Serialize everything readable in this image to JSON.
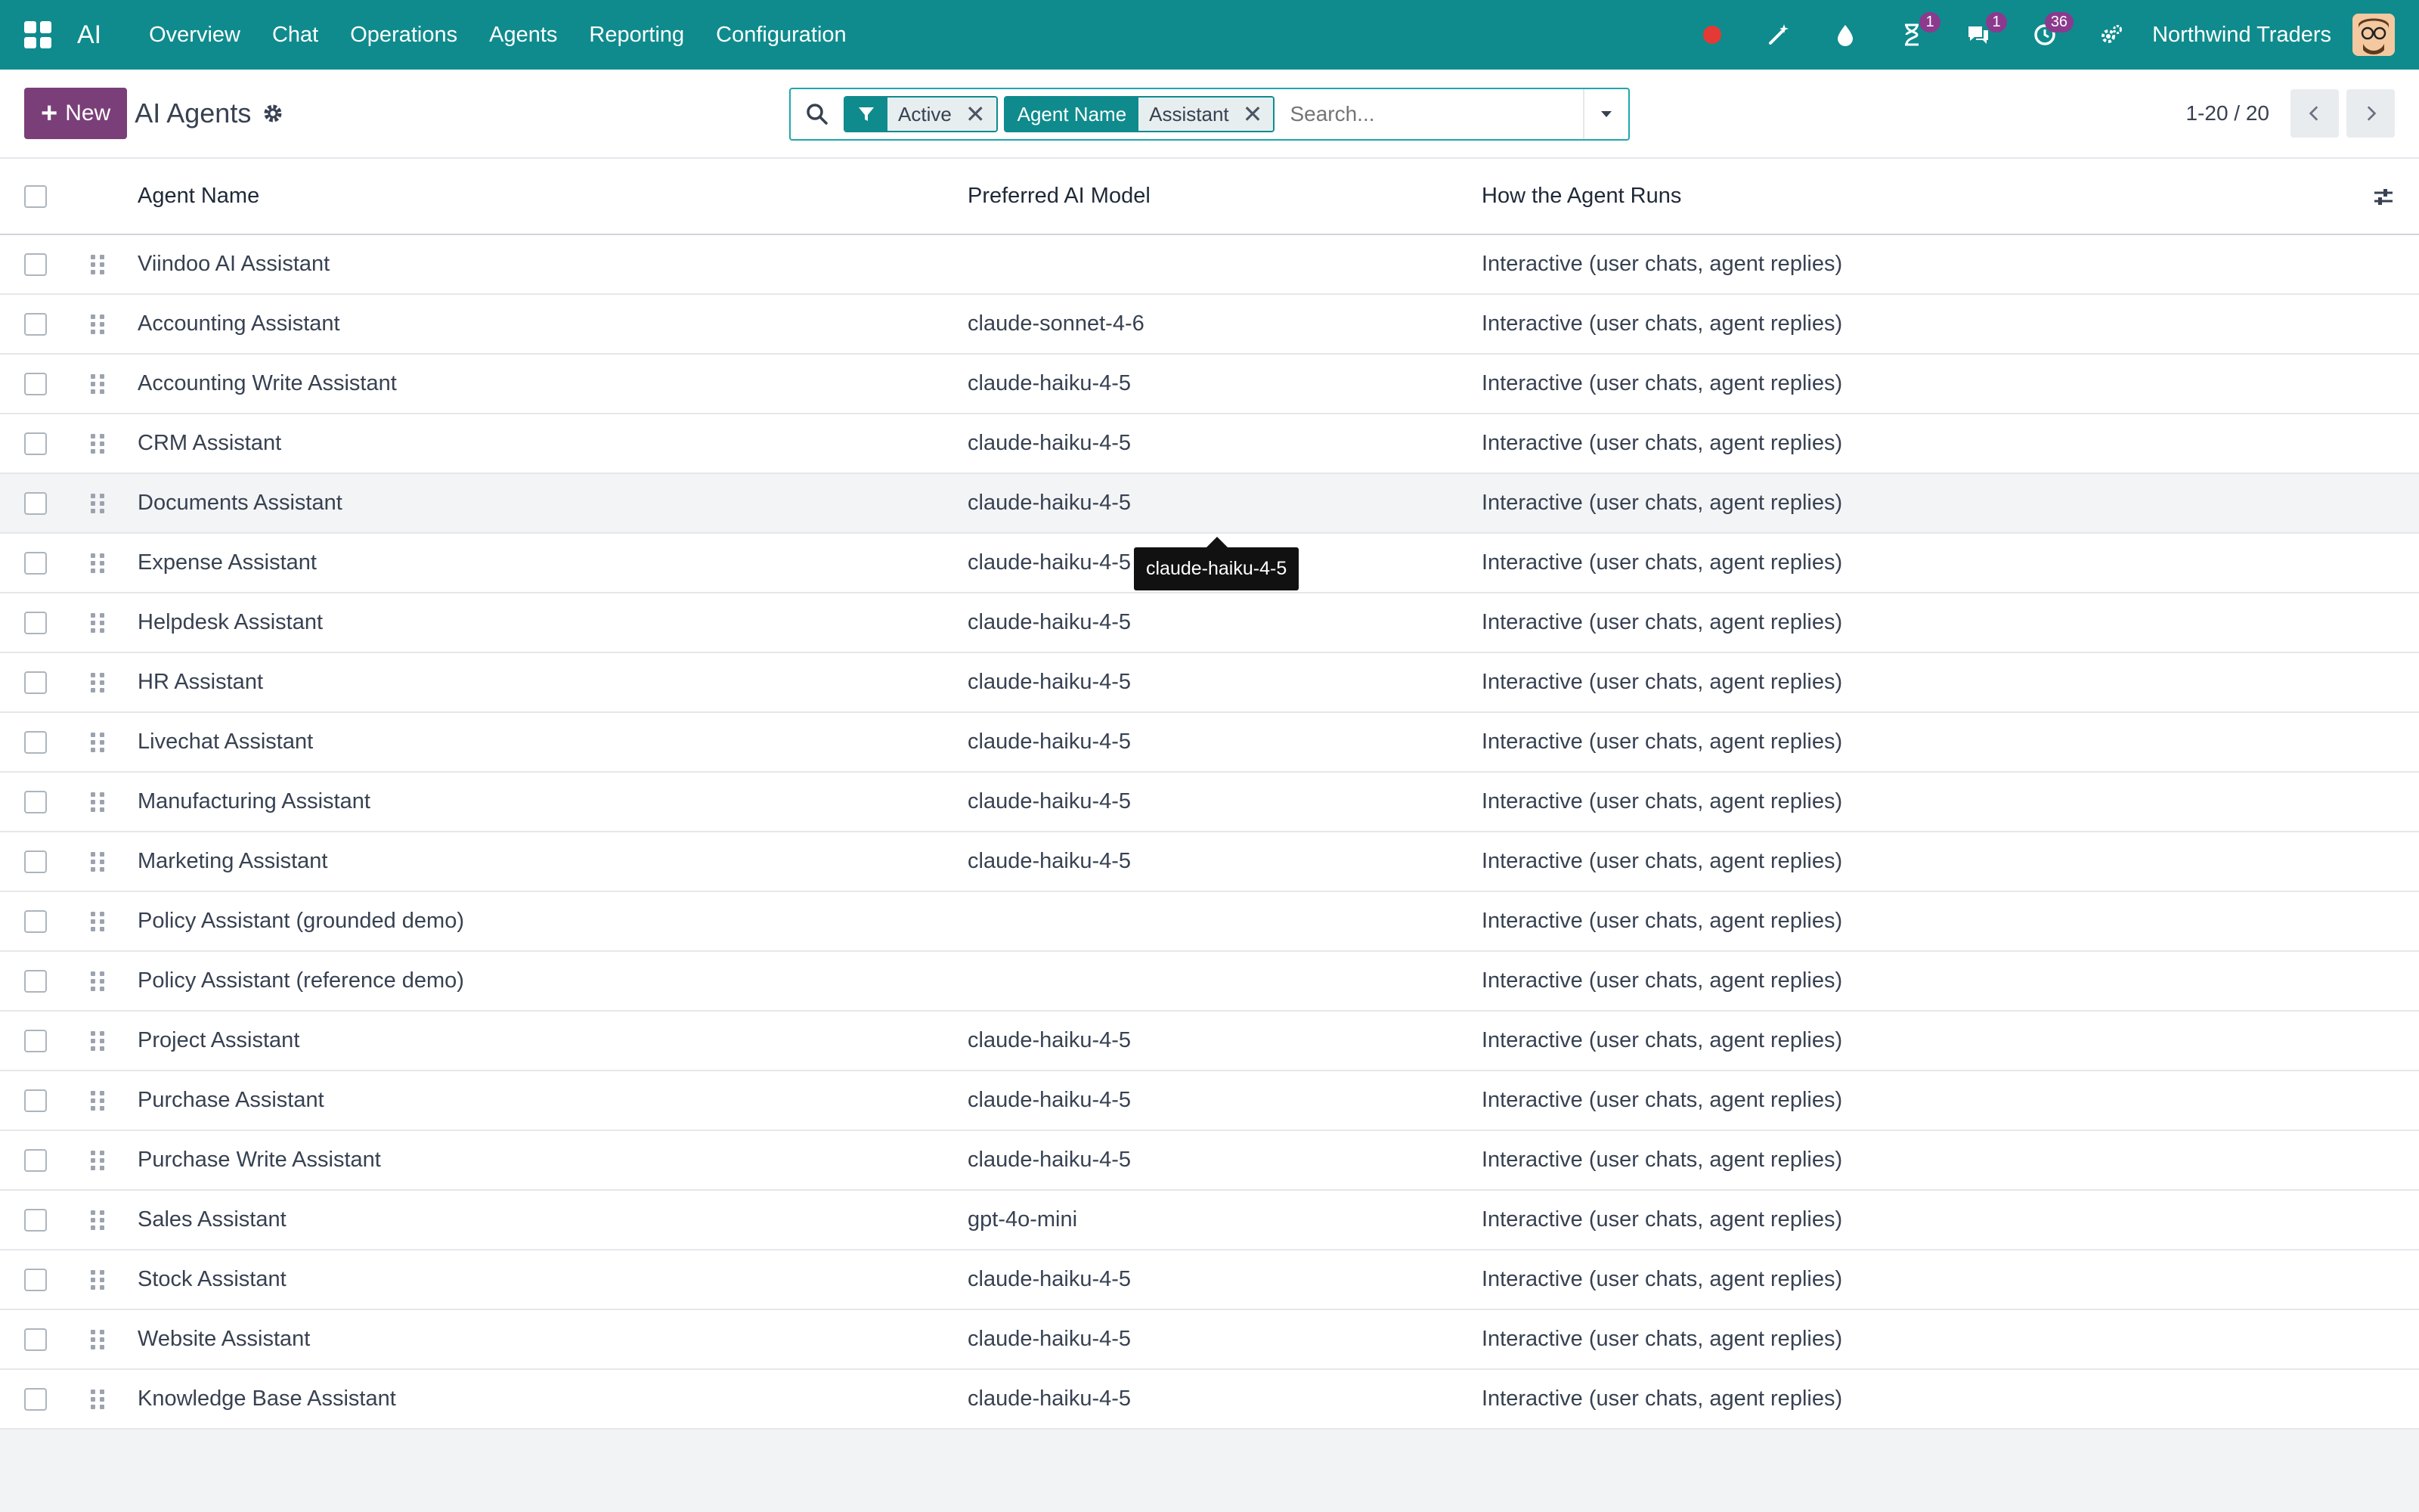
{
  "navbar": {
    "brand": "AI",
    "menu": [
      {
        "label": "Overview"
      },
      {
        "label": "Chat"
      },
      {
        "label": "Operations"
      },
      {
        "label": "Agents"
      },
      {
        "label": "Reporting"
      },
      {
        "label": "Configuration"
      }
    ],
    "icons": [
      "record-icon",
      "magic-wand-icon",
      "drop-icon",
      "hourglass-icon",
      "chat-bubbles-icon",
      "clock-icon",
      "settings-icon"
    ],
    "badges": {
      "activities": "1",
      "messages": "1",
      "clock": "36"
    },
    "company": "Northwind Traders"
  },
  "control": {
    "new_label": "New",
    "title": "AI Agents",
    "search": {
      "facets": [
        {
          "label": "",
          "value": "Active"
        },
        {
          "label": "Agent Name",
          "value": "Assistant"
        }
      ],
      "placeholder": "Search..."
    },
    "pager": "1-20 / 20"
  },
  "table": {
    "headers": {
      "name": "Agent Name",
      "model": "Preferred AI Model",
      "runs": "How the Agent Runs"
    },
    "rows": [
      {
        "name": "Viindoo AI Assistant",
        "model": "",
        "runs": "Interactive (user chats, agent replies)"
      },
      {
        "name": "Accounting Assistant",
        "model": "claude-sonnet-4-6",
        "runs": "Interactive (user chats, agent replies)"
      },
      {
        "name": "Accounting Write Assistant",
        "model": "claude-haiku-4-5",
        "runs": "Interactive (user chats, agent replies)"
      },
      {
        "name": "CRM Assistant",
        "model": "claude-haiku-4-5",
        "runs": "Interactive (user chats, agent replies)"
      },
      {
        "name": "Documents Assistant",
        "model": "claude-haiku-4-5",
        "runs": "Interactive (user chats, agent replies)"
      },
      {
        "name": "Expense Assistant",
        "model": "claude-haiku-4-5",
        "runs": "Interactive (user chats, agent replies)"
      },
      {
        "name": "Helpdesk Assistant",
        "model": "claude-haiku-4-5",
        "runs": "Interactive (user chats, agent replies)"
      },
      {
        "name": "HR Assistant",
        "model": "claude-haiku-4-5",
        "runs": "Interactive (user chats, agent replies)"
      },
      {
        "name": "Livechat Assistant",
        "model": "claude-haiku-4-5",
        "runs": "Interactive (user chats, agent replies)"
      },
      {
        "name": "Manufacturing Assistant",
        "model": "claude-haiku-4-5",
        "runs": "Interactive (user chats, agent replies)"
      },
      {
        "name": "Marketing Assistant",
        "model": "claude-haiku-4-5",
        "runs": "Interactive (user chats, agent replies)"
      },
      {
        "name": "Policy Assistant (grounded demo)",
        "model": "",
        "runs": "Interactive (user chats, agent replies)"
      },
      {
        "name": "Policy Assistant (reference demo)",
        "model": "",
        "runs": "Interactive (user chats, agent replies)"
      },
      {
        "name": "Project Assistant",
        "model": "claude-haiku-4-5",
        "runs": "Interactive (user chats, agent replies)"
      },
      {
        "name": "Purchase Assistant",
        "model": "claude-haiku-4-5",
        "runs": "Interactive (user chats, agent replies)"
      },
      {
        "name": "Purchase Write Assistant",
        "model": "claude-haiku-4-5",
        "runs": "Interactive (user chats, agent replies)"
      },
      {
        "name": "Sales Assistant",
        "model": "gpt-4o-mini",
        "runs": "Interactive (user chats, agent replies)"
      },
      {
        "name": "Stock Assistant",
        "model": "claude-haiku-4-5",
        "runs": "Interactive (user chats, agent replies)"
      },
      {
        "name": "Website Assistant",
        "model": "claude-haiku-4-5",
        "runs": "Interactive (user chats, agent replies)"
      },
      {
        "name": "Knowledge Base Assistant",
        "model": "claude-haiku-4-5",
        "runs": "Interactive (user chats, agent replies)"
      }
    ]
  },
  "tooltip": {
    "text": "claude-haiku-4-5"
  },
  "colors": {
    "navbar": "#0f8b8d",
    "primary_button": "#7a3f78",
    "badge": "#8b3a8e"
  }
}
